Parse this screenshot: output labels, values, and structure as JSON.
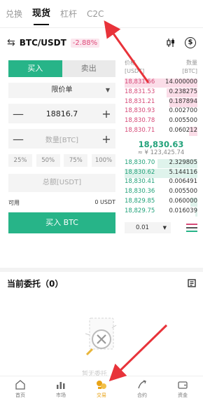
{
  "tabs": [
    {
      "label": "兑换",
      "active": false
    },
    {
      "label": "现货",
      "active": true
    },
    {
      "label": "杠杆",
      "active": false
    },
    {
      "label": "C2C",
      "active": false
    }
  ],
  "pair": {
    "swap_icon": "swap-icon",
    "symbol": "BTC/USDT",
    "change": "-2.88%"
  },
  "trade": {
    "buy_tab": "买入",
    "sell_tab": "卖出",
    "order_type": "限价单",
    "price_value": "18816.7",
    "amount_placeholder": "数量[BTC]",
    "percents": [
      "25%",
      "50%",
      "75%",
      "100%"
    ],
    "total_placeholder": "总额[USDT]",
    "available_label": "可用",
    "available_value": "0 USDT",
    "buy_button": "买入 BTC"
  },
  "orderbook": {
    "price_header_1": "价格",
    "price_header_2": "[USDT]",
    "qty_header_1": "数量",
    "qty_header_2": "[BTC]",
    "asks": [
      {
        "price": "18,831.56",
        "qty": "14.000000",
        "depth": 1.0
      },
      {
        "price": "18,831.53",
        "qty": "0.238275",
        "depth": 0.42
      },
      {
        "price": "18,831.21",
        "qty": "0.187894",
        "depth": 0.38
      },
      {
        "price": "18,830.93",
        "qty": "0.002700",
        "depth": 0.0
      },
      {
        "price": "18,830.78",
        "qty": "0.005500",
        "depth": 0.0
      },
      {
        "price": "18,830.71",
        "qty": "0.060212",
        "depth": 0.12
      }
    ],
    "last_price": "18,830.63",
    "fiat_price": "≈ ¥ 123,425.74",
    "bids": [
      {
        "price": "18,830.70",
        "qty": "2.329805",
        "depth": 0.55
      },
      {
        "price": "18,830.62",
        "qty": "5.144116",
        "depth": 1.0
      },
      {
        "price": "18,830.41",
        "qty": "0.006491",
        "depth": 0.0
      },
      {
        "price": "18,830.36",
        "qty": "0.005500",
        "depth": 0.0
      },
      {
        "price": "18,829.85",
        "qty": "0.060000",
        "depth": 0.1
      },
      {
        "price": "18,829.75",
        "qty": "0.016039",
        "depth": 0.03
      }
    ],
    "depth_select": "0.01"
  },
  "orders": {
    "title": "当前委托（0）",
    "empty_label": "暂无委托"
  },
  "nav": [
    {
      "label": "首页",
      "icon": "home-icon",
      "active": false
    },
    {
      "label": "市场",
      "icon": "market-icon",
      "active": false
    },
    {
      "label": "交易",
      "icon": "trade-icon",
      "active": true
    },
    {
      "label": "合约",
      "icon": "contract-icon",
      "active": false
    },
    {
      "label": "资金",
      "icon": "wallet-icon",
      "active": false
    }
  ],
  "colors": {
    "buy": "#27b488",
    "sell": "#d64a78",
    "accent": "#e8a317",
    "arrow": "#e8333a"
  }
}
